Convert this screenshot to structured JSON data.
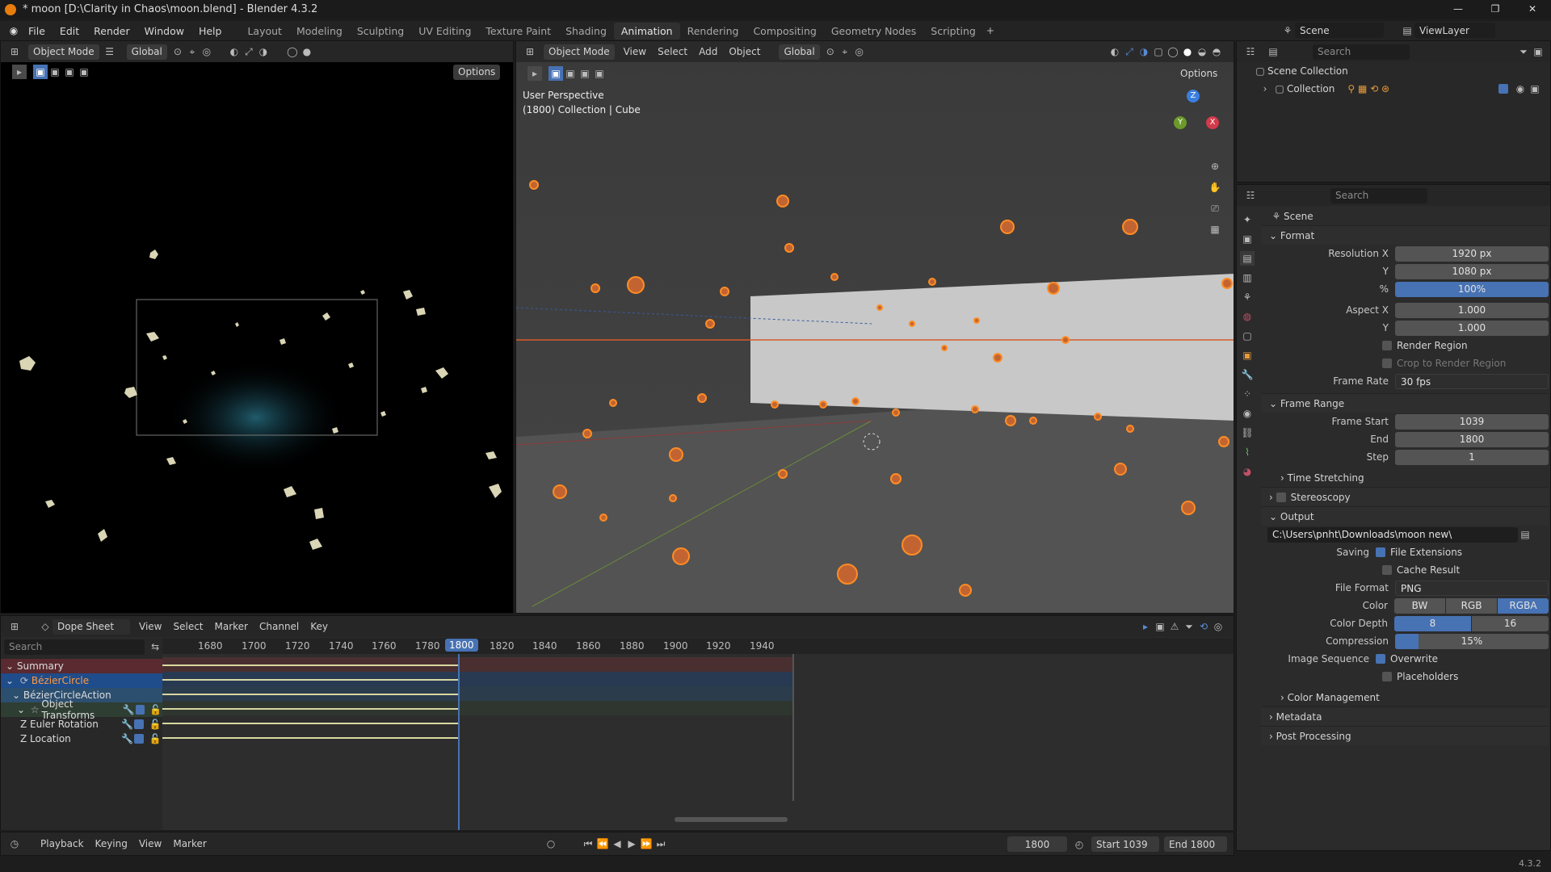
{
  "window": {
    "title": "* moon [D:\\Clarity in Chaos\\moon.blend] - Blender 4.3.2",
    "controls": [
      "—",
      "❐",
      "✕"
    ]
  },
  "menu": {
    "items": [
      "File",
      "Edit",
      "Render",
      "Window",
      "Help"
    ],
    "workspaces": [
      "Layout",
      "Modeling",
      "Sculpting",
      "UV Editing",
      "Texture Paint",
      "Shading",
      "Animation",
      "Rendering",
      "Compositing",
      "Geometry Nodes",
      "Scripting"
    ],
    "active_workspace": "Animation",
    "scene": "Scene",
    "view_layer": "ViewLayer"
  },
  "image_editor": {
    "mode": "Object Mode",
    "orientation": "Global",
    "options": "Options"
  },
  "viewport": {
    "mode": "Object Mode",
    "menus": [
      "View",
      "Select",
      "Add",
      "Object"
    ],
    "orientation": "Global",
    "options": "Options",
    "overlay_line1": "User Perspective",
    "overlay_line2": "(1800) Collection | Cube",
    "gizmo": {
      "z": "Z",
      "y": "Y",
      "x": "X"
    }
  },
  "outliner": {
    "search_placeholder": "Search",
    "scene_collection": "Scene Collection",
    "collection": "Collection"
  },
  "properties": {
    "search_placeholder": "Search",
    "context": "Scene",
    "format": {
      "title": "Format",
      "res_x_label": "Resolution X",
      "res_x": "1920 px",
      "res_y_label": "Y",
      "res_y": "1080 px",
      "pct_label": "%",
      "pct": "100%",
      "aspect_x_label": "Aspect X",
      "aspect_x": "1.000",
      "aspect_y_label": "Y",
      "aspect_y": "1.000",
      "render_region": "Render Region",
      "crop": "Crop to Render Region",
      "frame_rate_label": "Frame Rate",
      "frame_rate": "30 fps"
    },
    "frame_range": {
      "title": "Frame Range",
      "start_label": "Frame Start",
      "start": "1039",
      "end_label": "End",
      "end": "1800",
      "step_label": "Step",
      "step": "1",
      "time_stretching": "Time Stretching"
    },
    "stereoscopy": "Stereoscopy",
    "output": {
      "title": "Output",
      "path": "C:\\Users\\pnht\\Downloads\\moon new\\",
      "saving_label": "Saving",
      "file_ext": "File Extensions",
      "cache": "Cache Result",
      "format_label": "File Format",
      "format": "PNG",
      "color_label": "Color",
      "color_opts": [
        "BW",
        "RGB",
        "RGBA"
      ],
      "color_active": "RGBA",
      "depth_label": "Color Depth",
      "depth_opts": [
        "8",
        "16"
      ],
      "compression_label": "Compression",
      "compression": "15%",
      "compression_value": 0.15,
      "seq_label": "Image Sequence",
      "overwrite": "Overwrite",
      "placeholders": "Placeholders",
      "color_mgmt": "Color Management"
    },
    "metadata": "Metadata",
    "post": "Post Processing"
  },
  "dopesheet": {
    "mode": "Dope Sheet",
    "menus": [
      "View",
      "Select",
      "Marker",
      "Channel",
      "Key"
    ],
    "search_placeholder": "Search",
    "ticks": [
      "1680",
      "1700",
      "1720",
      "1740",
      "1760",
      "1780",
      "1800",
      "1820",
      "1840",
      "1860",
      "1880",
      "1900",
      "1920",
      "1940"
    ],
    "current_frame": "1800",
    "channels": [
      "Summary",
      "BézierCircle",
      "BézierCircleAction",
      "Object Transforms",
      "Z Euler Rotation",
      "Z Location"
    ]
  },
  "timeline": {
    "menus": [
      "Playback",
      "Keying",
      "View",
      "Marker"
    ],
    "frame": "1800",
    "start_label": "Start",
    "start": "1039",
    "end_label": "End",
    "end": "1800"
  },
  "status": {
    "version": "4.3.2"
  },
  "colors": {
    "accent": "#4772b3",
    "selected": "#ff8c24",
    "active_frame": "#4772b3"
  }
}
